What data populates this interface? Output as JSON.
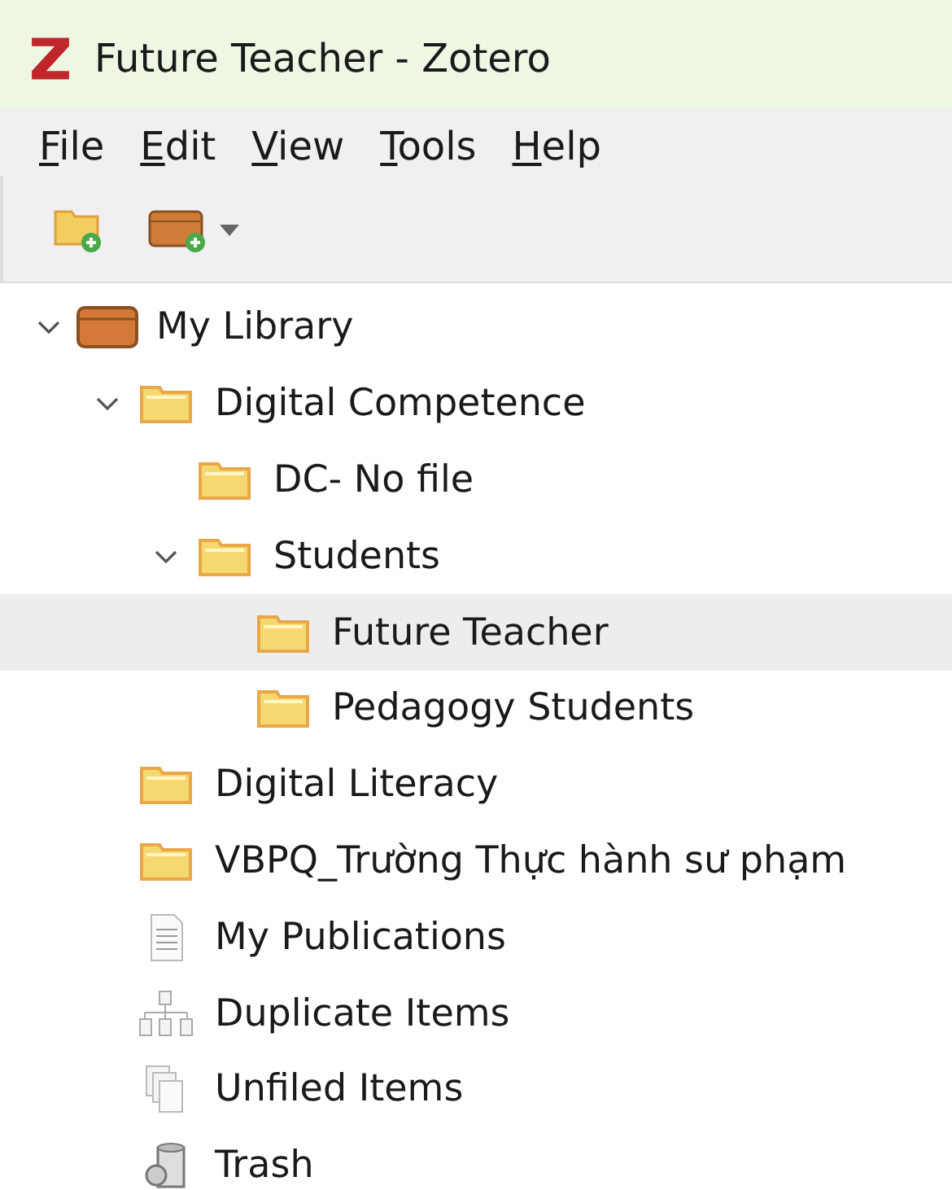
{
  "window": {
    "title": "Future Teacher - Zotero"
  },
  "menu": [
    "File",
    "Edit",
    "View",
    "Tools",
    "Help"
  ],
  "toolbar": [
    {
      "kind": "new-collection"
    },
    {
      "kind": "new-library",
      "has_menu": true
    }
  ],
  "tree": [
    {
      "kind": "library",
      "label": "My Library",
      "selected": false,
      "expanded": true,
      "children": [
        {
          "kind": "folder",
          "label": "Digital Competence",
          "selected": false,
          "expanded": true,
          "children": [
            {
              "kind": "folder",
              "label": "DC- No file",
              "selected": false
            },
            {
              "kind": "folder",
              "label": "Students",
              "selected": false,
              "expanded": true,
              "children": [
                {
                  "kind": "folder",
                  "label": "Future Teacher",
                  "selected": true
                },
                {
                  "kind": "folder",
                  "label": "Pedagogy Students",
                  "selected": false
                }
              ]
            }
          ]
        },
        {
          "kind": "folder",
          "label": "Digital Literacy",
          "selected": false
        },
        {
          "kind": "folder",
          "label": "VBPQ_Trường Thực hành sư phạm",
          "selected": false
        },
        {
          "kind": "publications",
          "label": "My Publications",
          "selected": false
        },
        {
          "kind": "duplicates",
          "label": "Duplicate Items",
          "selected": false
        },
        {
          "kind": "unfiled",
          "label": "Unfiled Items",
          "selected": false
        },
        {
          "kind": "trash",
          "label": "Trash",
          "selected": false
        }
      ]
    }
  ]
}
